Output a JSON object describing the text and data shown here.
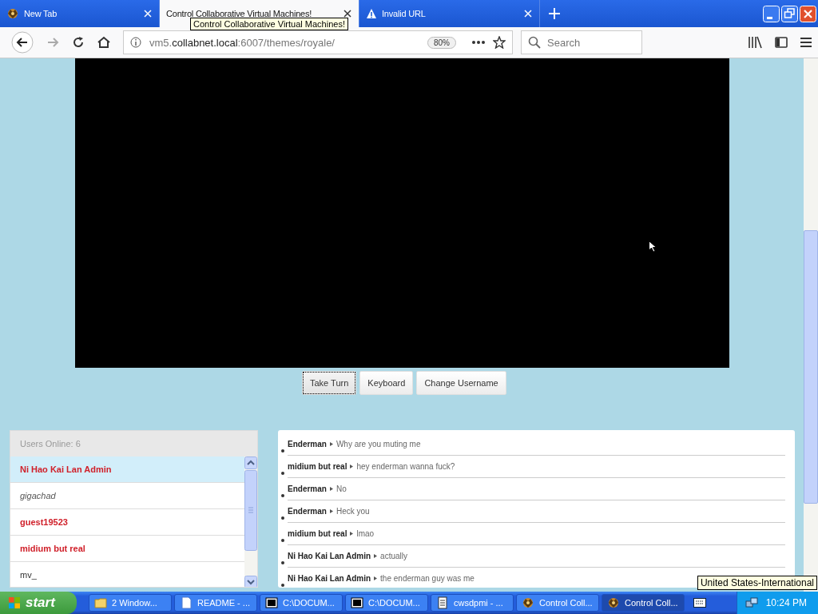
{
  "browser": {
    "tabs": [
      {
        "title": "New Tab",
        "kind": "plain",
        "selected": false
      },
      {
        "title": "Control Collaborative Virtual Machines!",
        "kind": "plain",
        "selected": true
      },
      {
        "title": "Invalid URL",
        "kind": "warning",
        "selected": false
      }
    ],
    "tab_tooltip": "Control Collaborative Virtual Machines!",
    "url": {
      "prefix": "vm5.",
      "domain": "collabnet.local",
      "suffix": ":6007/themes/royale/"
    },
    "zoom": "80%",
    "search": {
      "placeholder": "Search"
    }
  },
  "vm": {
    "buttons": [
      {
        "label": "Take Turn",
        "focused": true
      },
      {
        "label": "Keyboard",
        "focused": false
      },
      {
        "label": "Change Username",
        "focused": false
      }
    ]
  },
  "users": {
    "header": "Users Online: 6",
    "items": [
      {
        "name": "Ni Hao Kai Lan Admin",
        "kind": "registered",
        "selected": true
      },
      {
        "name": "gigachad",
        "kind": "anonymous",
        "selected": false
      },
      {
        "name": "guest19523",
        "kind": "registered",
        "selected": false
      },
      {
        "name": "midium but real",
        "kind": "registered",
        "selected": false
      },
      {
        "name": "mv_",
        "kind": "plain",
        "selected": false
      }
    ]
  },
  "chat": {
    "messages": [
      {
        "user": "Enderman",
        "text": "Why are you muting me"
      },
      {
        "user": "midium but real",
        "text": "hey enderman wanna fuck?"
      },
      {
        "user": "Enderman",
        "text": "No"
      },
      {
        "user": "Enderman",
        "text": "Heck you"
      },
      {
        "user": "midium but real",
        "text": "lmao"
      },
      {
        "user": "Ni Hao Kai Lan Admin",
        "text": "actually"
      },
      {
        "user": "Ni Hao Kai Lan Admin",
        "text": "the enderman guy was me"
      }
    ]
  },
  "keyboard_tooltip": "United States-International",
  "taskbar": {
    "start": "start",
    "items": [
      {
        "label": "2 Window...",
        "kind": "folder",
        "selected": false
      },
      {
        "label": "README - ...",
        "kind": "document",
        "selected": false
      },
      {
        "label": "C:\\DOCUM...",
        "kind": "archive",
        "selected": false
      },
      {
        "label": "C:\\DOCUM...",
        "kind": "archive",
        "selected": false
      },
      {
        "label": "cwsdpmi - ...",
        "kind": "notepad",
        "selected": false
      },
      {
        "label": "Control Coll...",
        "kind": "browser",
        "selected": false
      },
      {
        "label": "Control Coll...",
        "kind": "browser",
        "selected": true
      }
    ],
    "clock": "10:24 PM"
  }
}
